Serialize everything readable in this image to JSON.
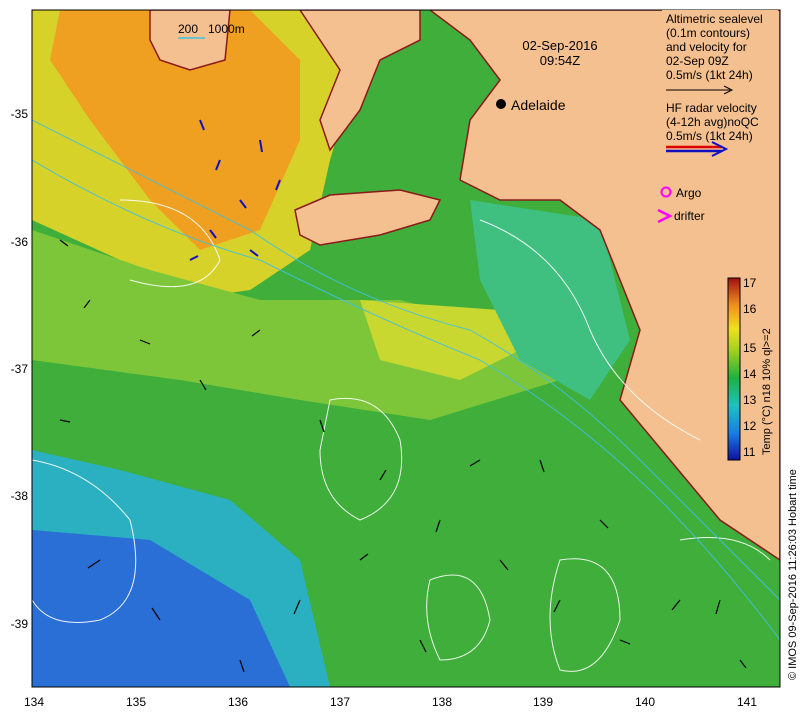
{
  "map": {
    "date": "02-Sep-2016",
    "time": "09:54Z",
    "city_label": "Adelaide",
    "depth_legend": {
      "a": "200",
      "b": "1000m"
    },
    "altimetry_lines": [
      "Altimetric sealevel",
      "(0.1m contours)",
      "and velocity for",
      "02-Sep 09Z",
      "0.5m/s (1kt 24h)"
    ],
    "radar_lines": [
      "HF radar velocity",
      "(4-12h avg)noQC",
      "0.5m/s (1kt 24h)"
    ],
    "argo_label": "Argo",
    "drifter_label": "drifter",
    "colorbar_title": "Temp (°C) n18 10% ql>=2",
    "colorbar_ticks": [
      "11",
      "12",
      "13",
      "14",
      "15",
      "16",
      "17"
    ],
    "x_ticks": [
      "134",
      "135",
      "136",
      "137",
      "138",
      "139",
      "140",
      "141"
    ],
    "y_ticks": [
      "-35",
      "-36",
      "-37",
      "-38",
      "-39"
    ],
    "credit": "© IMOS 09-Sep-2016 11:26:03 Hobart time",
    "colors": {
      "land": "#f5c08f",
      "coast": "#8b1a1a",
      "cold": "#2a6fd6",
      "warm": "#f0a020",
      "argo": "#ff00ff"
    }
  }
}
